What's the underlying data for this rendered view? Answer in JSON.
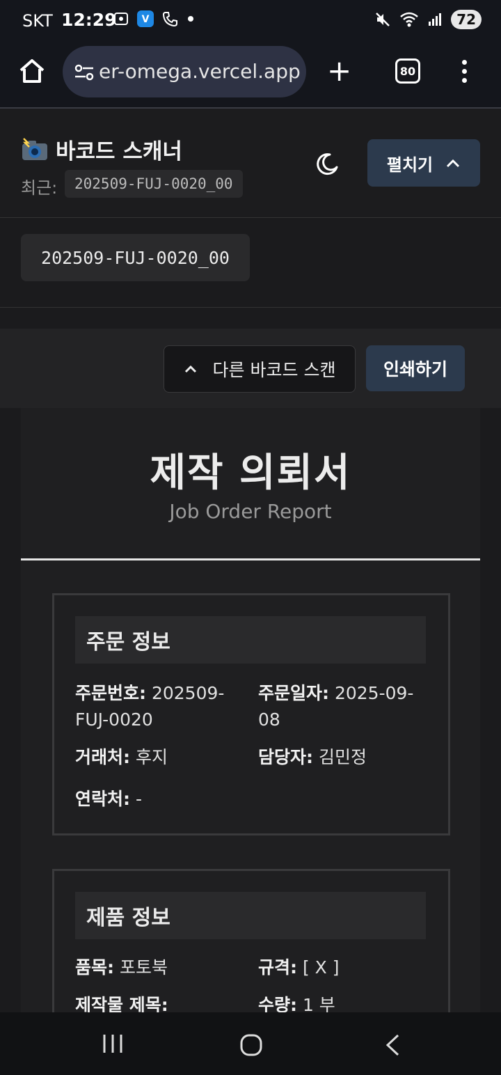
{
  "status_bar": {
    "carrier": "SKT",
    "time": "12:29",
    "battery": "72"
  },
  "browser": {
    "url": "er-omega.vercel.app",
    "tab_count": "80"
  },
  "app": {
    "title": "바코드 스캐너",
    "recent_label": "최근:",
    "recent_code": "202509-FUJ-0020_00",
    "expand_label": "펼치기"
  },
  "current_code": "202509-FUJ-0020_00",
  "actions": {
    "rescan_label": "다른 바코드 스캔",
    "print_label": "인쇄하기"
  },
  "document": {
    "title": "제작 의뢰서",
    "subtitle": "Job Order Report",
    "order_section": {
      "heading": "주문 정보",
      "order_no_label": "주문번호:",
      "order_no": "202509-FUJ-0020",
      "order_date_label": "주문일자:",
      "order_date": "2025-09-08",
      "client_label": "거래처:",
      "client": "후지",
      "manager_label": "담당자:",
      "manager": "김민정",
      "contact_label": "연락처:",
      "contact": "-"
    },
    "product_section": {
      "heading": "제품 정보",
      "item_label": "품목:",
      "item": "포토북",
      "spec_label": "규격:",
      "spec": "[ X ]",
      "product_title_label": "제작물 제목:",
      "quantity_label": "수량:",
      "quantity": "1 부"
    }
  }
}
